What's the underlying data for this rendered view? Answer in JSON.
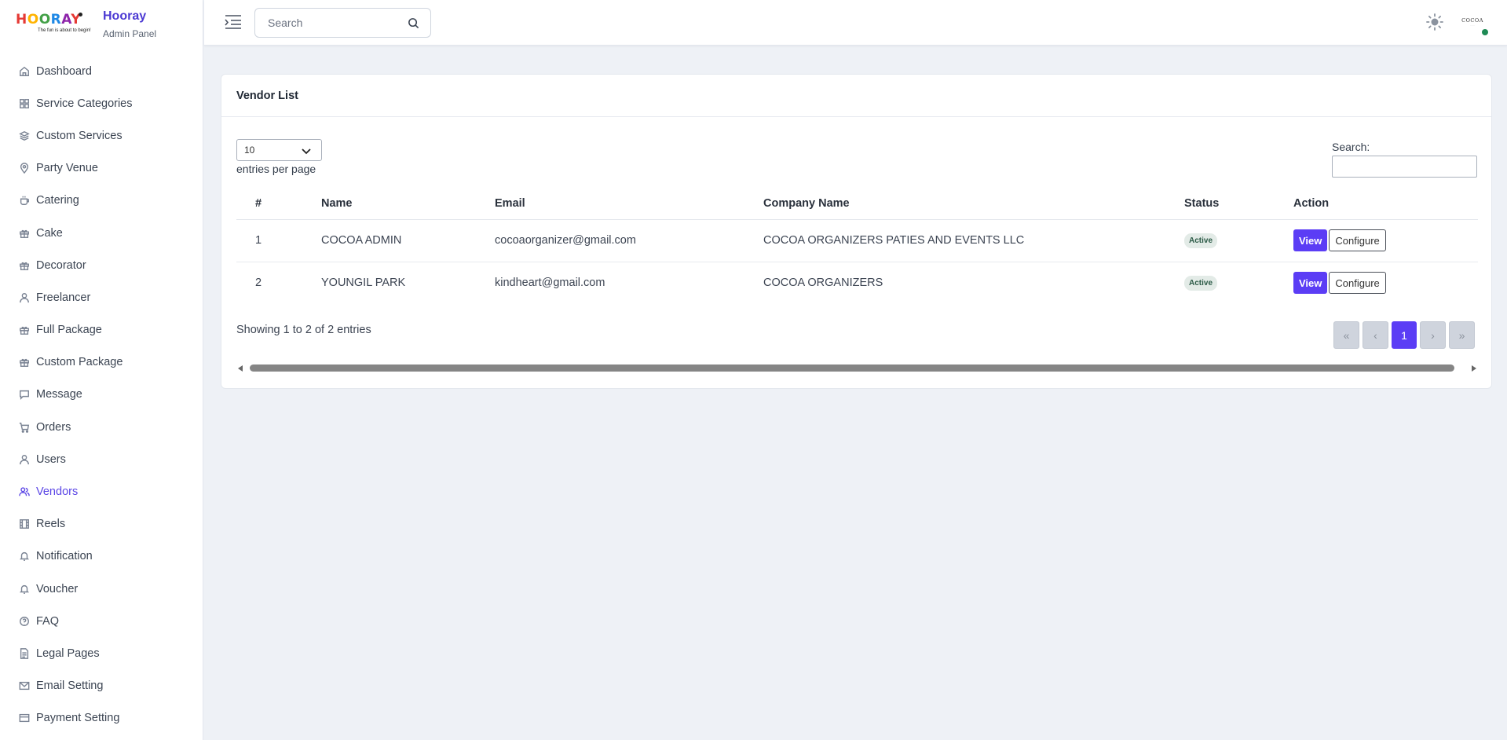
{
  "brand": {
    "logo_text": "HOORAY",
    "logo_tagline": "The fun is about to begin!",
    "title": "Hooray",
    "subtitle": "Admin Panel"
  },
  "sidebar": {
    "items": [
      {
        "label": "Dashboard",
        "icon": "home-icon"
      },
      {
        "label": "Service Categories",
        "icon": "grid-icon"
      },
      {
        "label": "Custom Services",
        "icon": "layers-icon"
      },
      {
        "label": "Party Venue",
        "icon": "map-pin-icon"
      },
      {
        "label": "Catering",
        "icon": "cup-icon"
      },
      {
        "label": "Cake",
        "icon": "gift-icon"
      },
      {
        "label": "Decorator",
        "icon": "gift-icon"
      },
      {
        "label": "Freelancer",
        "icon": "user-icon"
      },
      {
        "label": "Full Package",
        "icon": "gift-icon"
      },
      {
        "label": "Custom Package",
        "icon": "gift-icon"
      },
      {
        "label": "Message",
        "icon": "message-icon"
      },
      {
        "label": "Orders",
        "icon": "cart-icon"
      },
      {
        "label": "Users",
        "icon": "user-icon"
      },
      {
        "label": "Vendors",
        "icon": "users-icon",
        "active": true
      },
      {
        "label": "Reels",
        "icon": "film-icon"
      },
      {
        "label": "Notification",
        "icon": "bell-icon"
      },
      {
        "label": "Voucher",
        "icon": "bell-icon"
      },
      {
        "label": "FAQ",
        "icon": "help-circle-icon"
      },
      {
        "label": "Legal Pages",
        "icon": "file-icon"
      },
      {
        "label": "Email Setting",
        "icon": "mail-icon"
      },
      {
        "label": "Payment Setting",
        "icon": "credit-card-icon"
      }
    ]
  },
  "topbar": {
    "search_placeholder": "Search",
    "avatar_text": "COCOA",
    "avatar_status_color": "#1e8a55"
  },
  "main": {
    "card_title": "Vendor List",
    "entries_value": "10",
    "entries_label": "entries per page",
    "search_label": "Search:",
    "columns": [
      "#",
      "Name",
      "Email",
      "Company Name",
      "Status",
      "Action"
    ],
    "rows": [
      {
        "num": "1",
        "name": "COCOA ADMIN",
        "email": "cocoaorganizer@gmail.com",
        "company": "COCOA ORGANIZERS PATIES AND EVENTS LLC",
        "status": "Active",
        "view": "View",
        "configure": "Configure"
      },
      {
        "num": "2",
        "name": "YOUNGIL PARK",
        "email": "kindheart@gmail.com",
        "company": "COCOA ORGANIZERS",
        "status": "Active",
        "view": "View",
        "configure": "Configure"
      }
    ],
    "showing_text": "Showing 1 to 2 of 2 entries",
    "pager": {
      "first": "«",
      "prev": "‹",
      "current": "1",
      "next": "›",
      "last": "»"
    }
  },
  "colors": {
    "accent": "#5b3df5",
    "active_nav": "#5b46e6",
    "brand_title": "#4c3ad3",
    "background": "#eef1f6"
  }
}
